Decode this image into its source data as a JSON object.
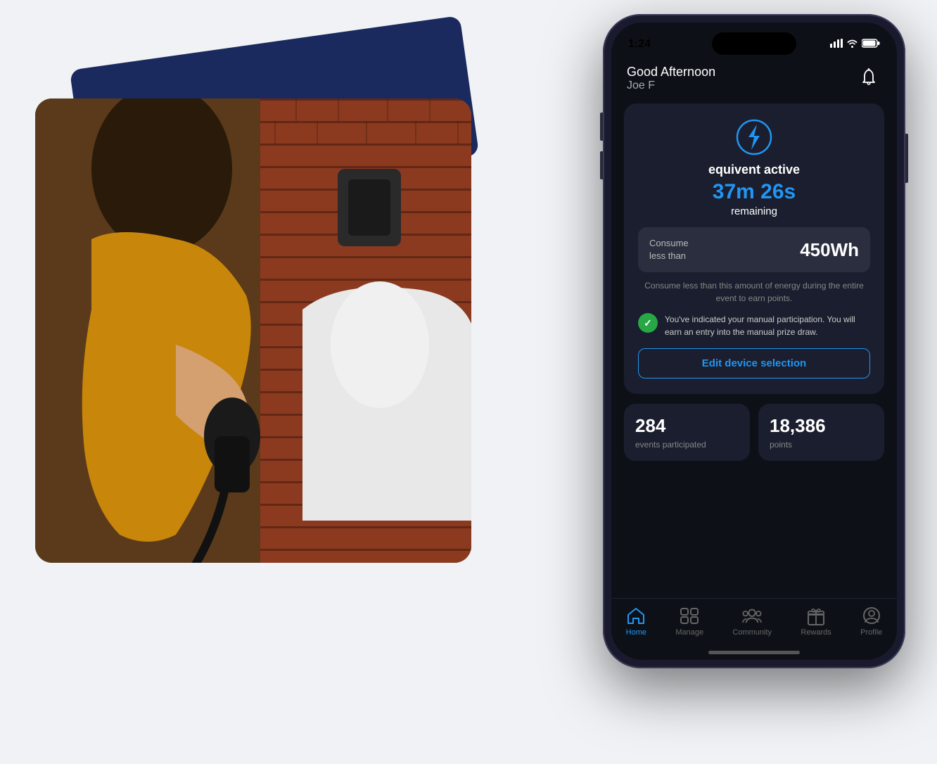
{
  "statusBar": {
    "time": "1:24",
    "locationIcon": "◂",
    "signalBars": "▐▐▐",
    "wifi": "wifi",
    "battery": "battery"
  },
  "header": {
    "greeting": "Good Afternoon",
    "name": "Joe F"
  },
  "activeCard": {
    "iconAlt": "equivent lightning bolt",
    "title": "equivent active",
    "timer": "37m 26s",
    "timerSuffix": "remaining",
    "energyLabel": "Consume\nless than",
    "energyValue": "450Wh",
    "description": "Consume less than this amount of energy during the entire event to earn points.",
    "participationText": "You've indicated your manual participation. You will earn an entry into the manual prize draw.",
    "editButtonLabel": "Edit device selection"
  },
  "stats": {
    "events": {
      "value": "284",
      "label": "events participated"
    },
    "points": {
      "value": "18,386",
      "label": "points"
    }
  },
  "bottomNav": {
    "items": [
      {
        "id": "home",
        "label": "Home",
        "active": true
      },
      {
        "id": "manage",
        "label": "Manage",
        "active": false
      },
      {
        "id": "community",
        "label": "Community",
        "active": false
      },
      {
        "id": "rewards",
        "label": "Rewards",
        "active": false
      },
      {
        "id": "profile",
        "label": "Profile",
        "active": false
      }
    ]
  }
}
